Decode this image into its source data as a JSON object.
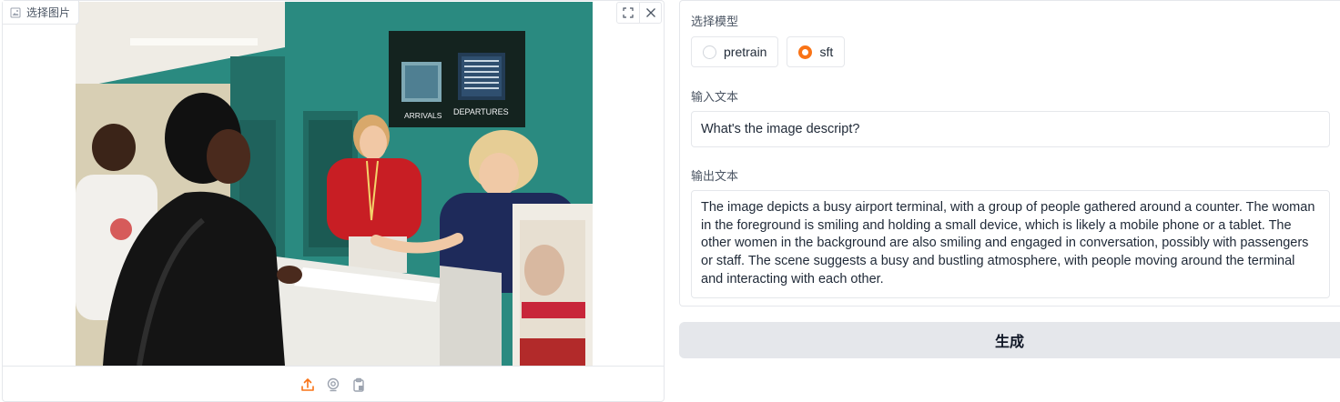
{
  "image_panel": {
    "label": "选择图片",
    "label_icon": "image-icon",
    "tools": [
      {
        "name": "fullscreen-icon"
      },
      {
        "name": "close-icon"
      }
    ],
    "sources": [
      {
        "name": "upload-icon",
        "active": true
      },
      {
        "name": "webcam-icon",
        "active": false
      },
      {
        "name": "clipboard-icon",
        "active": false
      }
    ],
    "photo": {
      "sign_left": "ARRIVALS",
      "sign_right": "DEPARTURES"
    }
  },
  "model_select": {
    "label": "选择模型",
    "options": [
      {
        "label": "pretrain",
        "checked": false
      },
      {
        "label": "sft",
        "checked": true
      }
    ]
  },
  "input": {
    "label": "输入文本",
    "value": "What's the image descript?"
  },
  "output": {
    "label": "输出文本",
    "value": "The image depicts a busy airport terminal, with a group of people gathered around a counter. The woman in the foreground is smiling and holding a small device, which is likely a mobile phone or a tablet. The other women in the background are also smiling and engaged in conversation, possibly with passengers or staff. The scene suggests a busy and bustling atmosphere, with people moving around the terminal and interacting with each other."
  },
  "generate_button": {
    "label": "生成"
  },
  "colors": {
    "accent": "#f97316",
    "border": "#e5e7eb",
    "button_bg": "#e5e7eb",
    "wall_teal": "#2a8a80"
  }
}
